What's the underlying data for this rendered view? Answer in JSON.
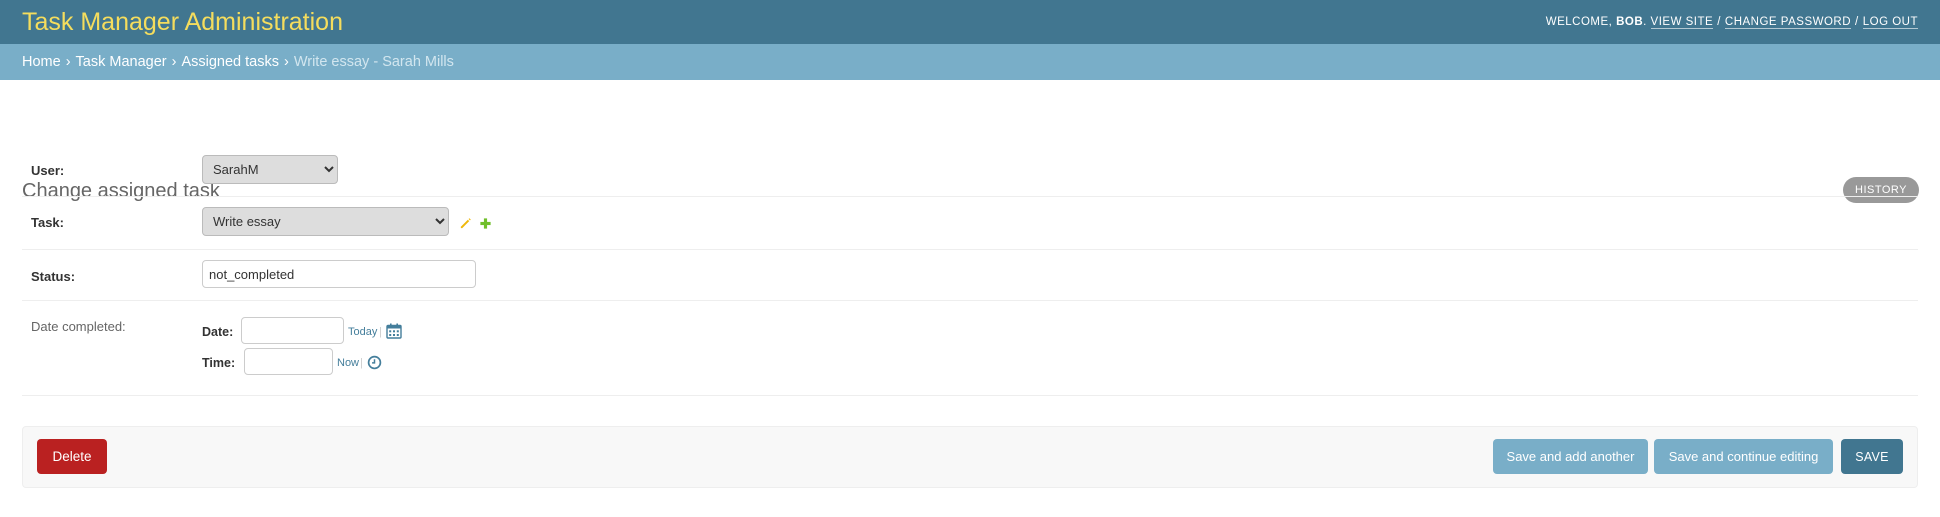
{
  "header": {
    "site_name": "Task Manager Administration",
    "welcome": "Welcome,",
    "username": "BOB",
    "view_site": "View site",
    "change_password": "Change password",
    "log_out": "Log out",
    "sep": "/"
  },
  "breadcrumbs": {
    "items": [
      "Home",
      "Task Manager",
      "Assigned tasks"
    ],
    "separator": "›",
    "current": "Write essay - Sarah Mills"
  },
  "page": {
    "title": "Change assigned task",
    "history_label": "History"
  },
  "form": {
    "user": {
      "label": "User:",
      "value": "SarahM"
    },
    "task": {
      "label": "Task:",
      "value": "Write essay",
      "edit_icon": "pencil-icon",
      "add_icon": "plus-icon"
    },
    "status": {
      "label": "Status:",
      "value": "not_completed"
    },
    "date_completed": {
      "label": "Date completed:",
      "date_label": "Date:",
      "date_value": "",
      "today_link": "Today",
      "sep": "|",
      "calendar_icon": "calendar-icon",
      "time_label": "Time:",
      "time_value": "",
      "now_link": "Now",
      "clock_icon": "clock-icon"
    }
  },
  "submit_row": {
    "delete": "Delete",
    "save_add_another": "Save and add another",
    "save_continue": "Save and continue editing",
    "save": "Save"
  },
  "colors": {
    "header_bg": "#417690",
    "site_name": "#f5dd5d",
    "breadcrumbs_bg": "#79aec8",
    "delete_bg": "#ba2121",
    "secondary_btn_bg": "#79aec8",
    "save_bg": "#417690",
    "history_bg": "#999999",
    "link": "#447e9b"
  }
}
